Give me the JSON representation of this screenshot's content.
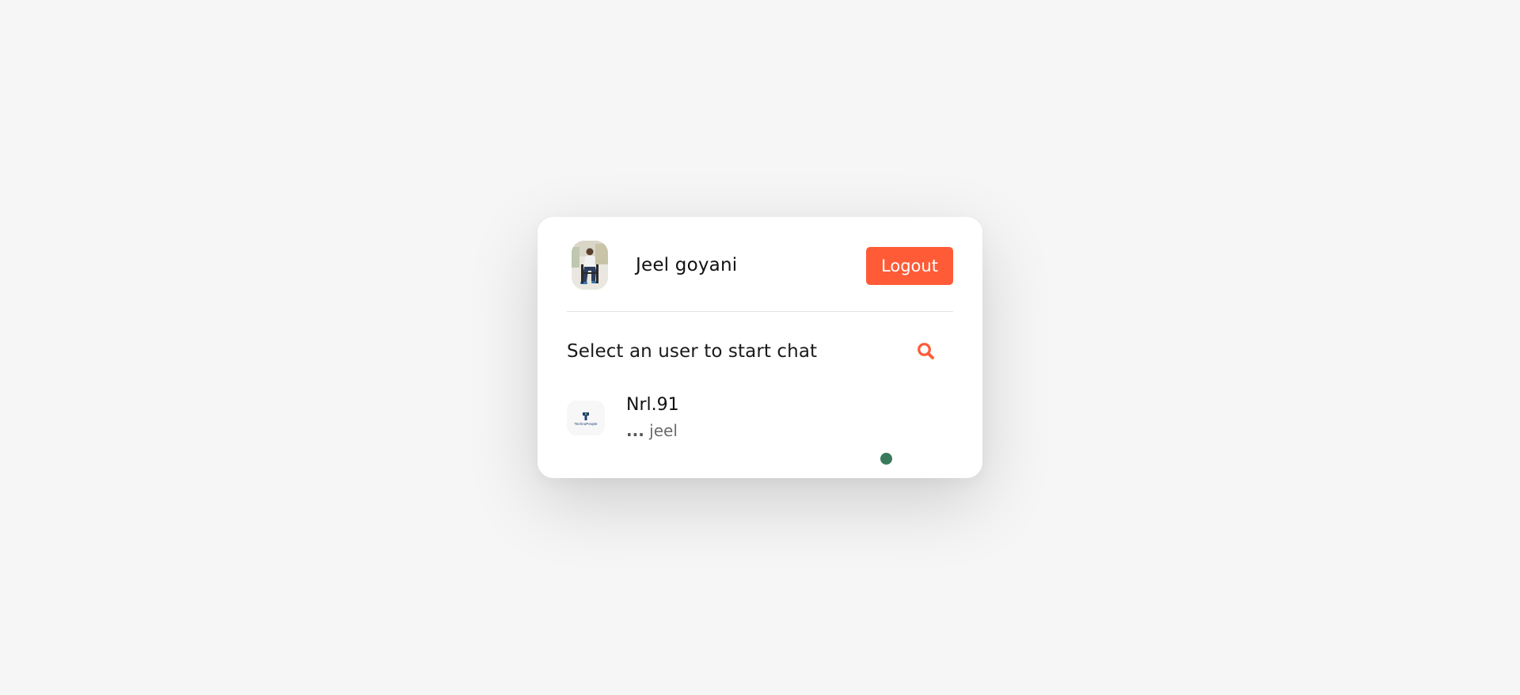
{
  "header": {
    "user_name": "Jeel goyani",
    "logout_label": "Logout"
  },
  "chat": {
    "prompt": "Select an user to start chat",
    "users": [
      {
        "name": "Nrl.91",
        "last_message_prefix": "...",
        "last_message": "jeel",
        "logo_text": "TechnoPeople",
        "status": "online"
      }
    ]
  },
  "icons": {
    "search": "search-icon",
    "avatar": "avatar-photo",
    "contact_logo": "company-logo"
  },
  "colors": {
    "accent": "#ff5b37",
    "online": "#3a7a5c",
    "background": "#f6f6f6",
    "card": "#ffffff"
  }
}
